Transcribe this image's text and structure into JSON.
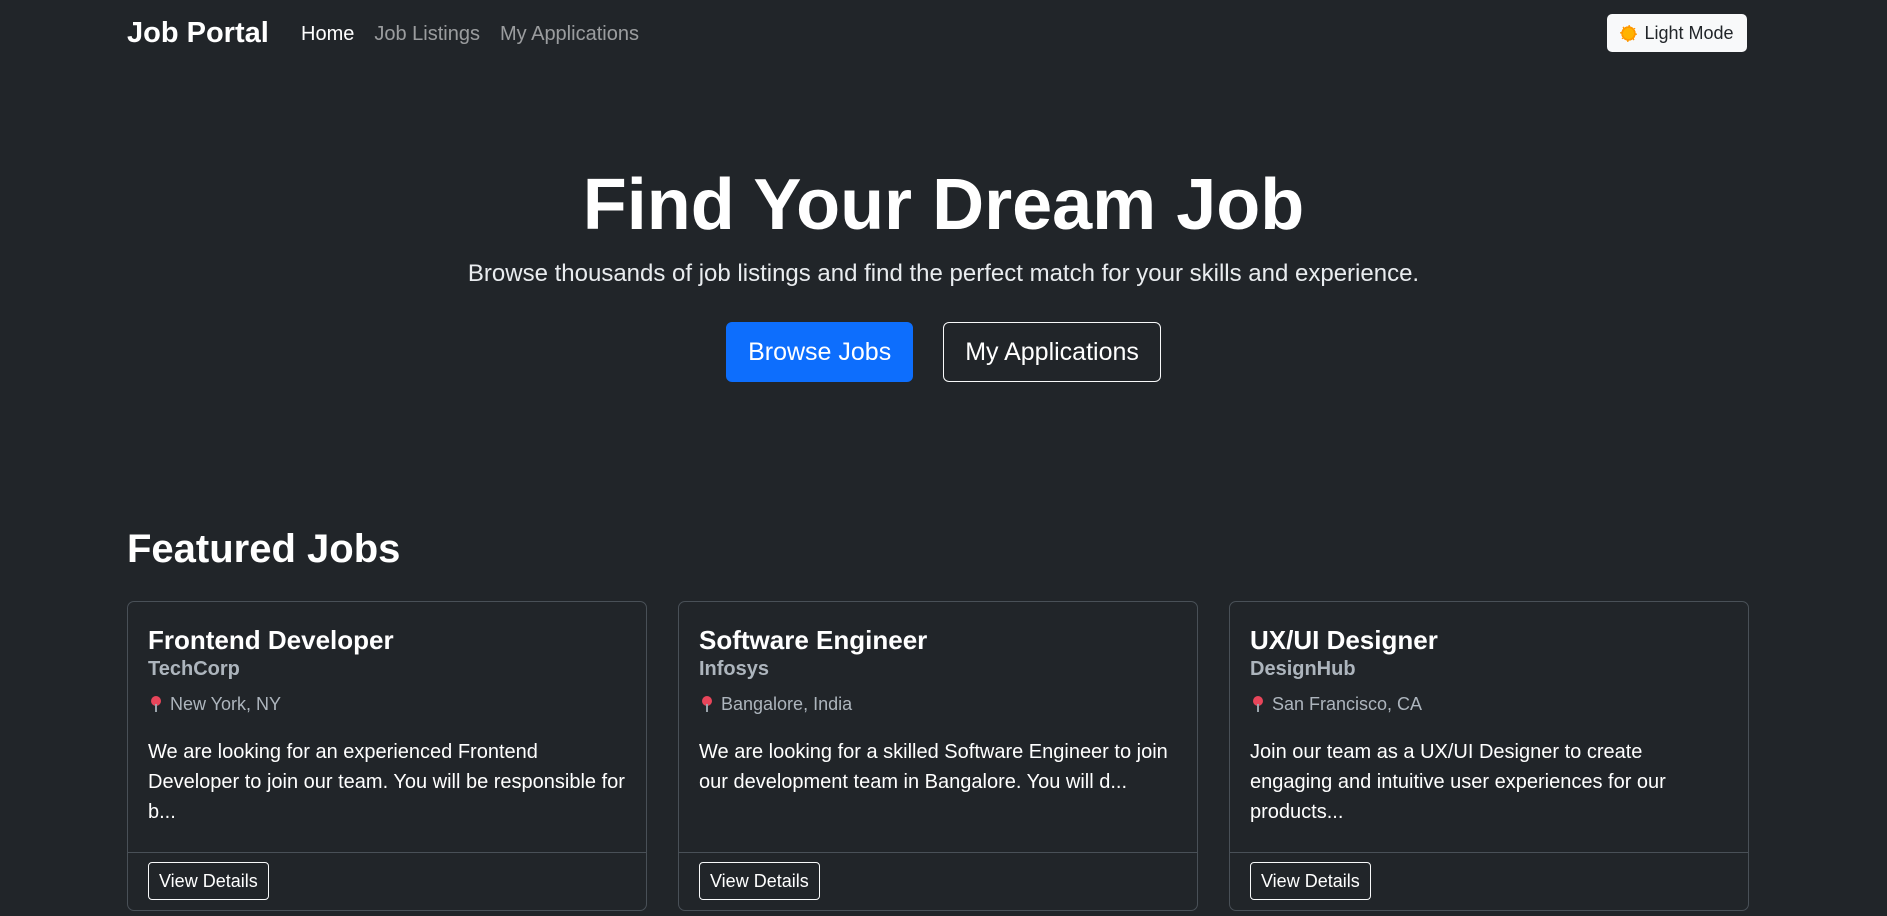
{
  "navbar": {
    "brand": "Job Portal",
    "links": [
      {
        "label": "Home"
      },
      {
        "label": "Job Listings"
      },
      {
        "label": "My Applications"
      }
    ],
    "theme_toggle_label": "Light Mode",
    "theme_toggle_icon": "sun-icon"
  },
  "hero": {
    "title": "Find Your Dream Job",
    "lead": "Browse thousands of job listings and find the perfect match for your skills and experience.",
    "primary_button": "Browse Jobs",
    "secondary_button": "My Applications"
  },
  "featured": {
    "title": "Featured Jobs",
    "jobs": [
      {
        "title": "Frontend Developer",
        "company": "TechCorp",
        "location": "New York, NY",
        "description": "We are looking for an experienced Frontend Developer to join our team. You will be responsible for b...",
        "button": "View Details"
      },
      {
        "title": "Software Engineer",
        "company": "Infosys",
        "location": "Bangalore, India",
        "description": "We are looking for a skilled Software Engineer to join our development team in Bangalore. You will d...",
        "button": "View Details"
      },
      {
        "title": "UX/UI Designer",
        "company": "DesignHub",
        "location": "San Francisco, CA",
        "description": "Join our team as a UX/UI Designer to create engaging and intuitive user experiences for our products...",
        "button": "View Details"
      }
    ]
  },
  "colors": {
    "background": "#212529",
    "primary": "#0d6efd",
    "muted": "#adb5bd",
    "border": "#495057"
  }
}
